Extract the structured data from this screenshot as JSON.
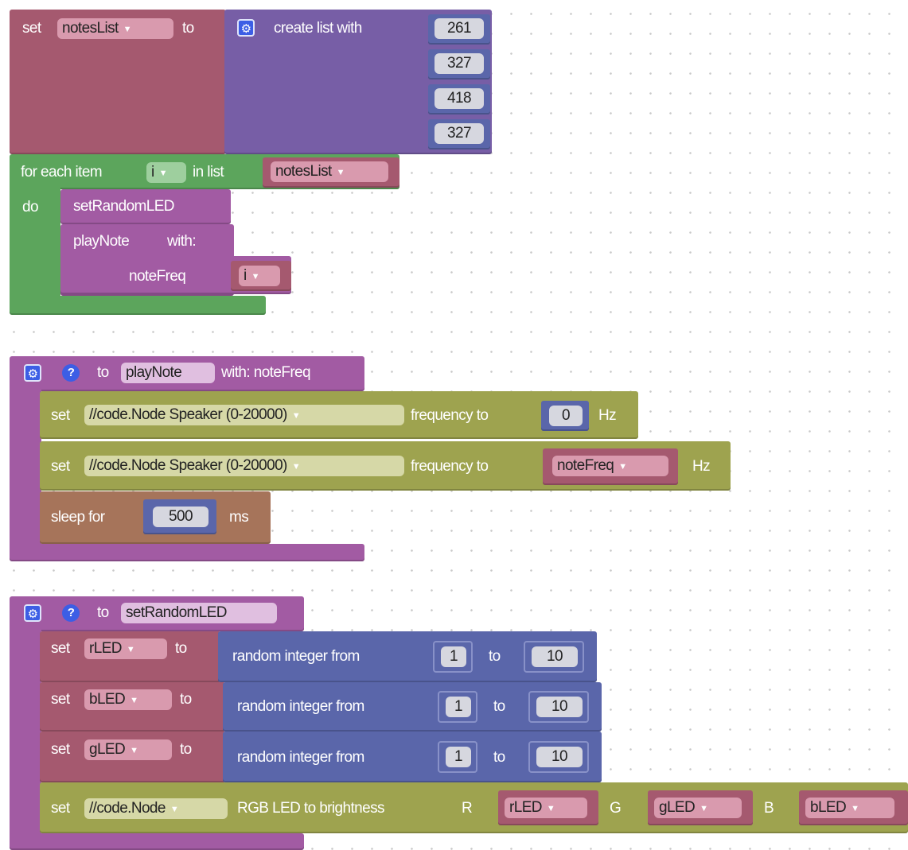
{
  "block1": {
    "set": "set",
    "var": "notesList",
    "to": "to",
    "create": "create list with",
    "items": [
      "261",
      "327",
      "418",
      "327"
    ]
  },
  "foreach": {
    "label": "for each item",
    "var": "i",
    "in_list": "in list",
    "list_var": "notesList",
    "do": "do",
    "call1": "setRandomLED",
    "call2": "playNote",
    "with": "with:",
    "param": "noteFreq",
    "param_var": "i"
  },
  "proc1": {
    "to": "to",
    "name": "playNote",
    "with": "with: noteFreq",
    "s1_set": "set",
    "s1_dev": "//code.Node Speaker (0-20000)",
    "s1_freq": "frequency to",
    "s1_val": "0",
    "s1_unit": "Hz",
    "s2_set": "set",
    "s2_dev": "//code.Node Speaker (0-20000)",
    "s2_freq": "frequency to",
    "s2_val": "noteFreq",
    "s2_unit": "Hz",
    "sleep": "sleep for",
    "sleep_val": "500",
    "sleep_unit": "ms"
  },
  "proc2": {
    "to": "to",
    "name": "setRandomLED",
    "rows": [
      {
        "set": "set",
        "var": "rLED",
        "to": "to",
        "rand": "random integer from",
        "from": "1",
        "to2": "to",
        "max": "10"
      },
      {
        "set": "set",
        "var": "bLED",
        "to": "to",
        "rand": "random integer from",
        "from": "1",
        "to2": "to",
        "max": "10"
      },
      {
        "set": "set",
        "var": "gLED",
        "to": "to",
        "rand": "random integer from",
        "from": "1",
        "to2": "to",
        "max": "10"
      }
    ],
    "rgb_set": "set",
    "rgb_dev": "//code.Node",
    "rgb_label": "RGB LED to brightness",
    "r": "R",
    "r_var": "rLED",
    "g": "G",
    "g_var": "gLED",
    "b": "B",
    "b_var": "bLED"
  },
  "icons": [
    "gear-icon",
    "help-icon",
    "dropdown-arrow-icon"
  ],
  "colors": {
    "variables": "#a5596f",
    "lists": "#775ea6",
    "math": "#5a66aa",
    "loops": "#5ca55c",
    "procedures": "#a25ba3",
    "hardware": "#9ea34f",
    "timing": "#a6745a"
  }
}
